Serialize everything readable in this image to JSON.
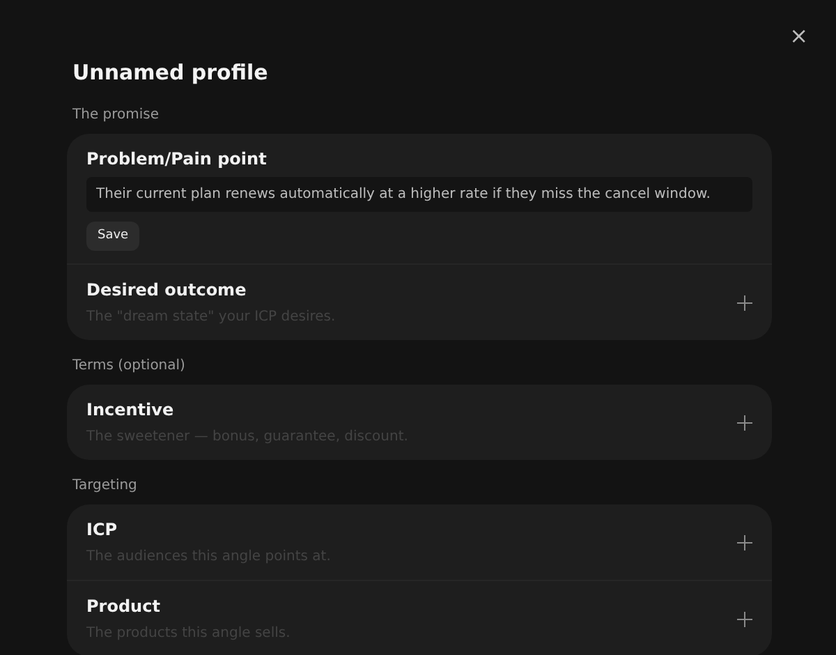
{
  "dialog": {
    "title": "Unnamed profile",
    "close_label": "×"
  },
  "sections": [
    {
      "label": "The promise",
      "fields": [
        {
          "kind": "editing",
          "label": "Problem/Pain point",
          "value": "Their current plan renews automatically at a higher rate if they miss the cancel window.",
          "button": "Save"
        },
        {
          "kind": "collapsed",
          "label": "Desired outcome",
          "description": "The \"dream state\" your ICP desires."
        }
      ]
    },
    {
      "label": "Terms (optional)",
      "fields": [
        {
          "kind": "collapsed",
          "label": "Incentive",
          "description": "The sweetener — bonus, guarantee, discount."
        }
      ]
    },
    {
      "label": "Targeting",
      "fields": [
        {
          "kind": "collapsed",
          "label": "ICP",
          "description": "The audiences this angle points at."
        },
        {
          "kind": "collapsed",
          "label": "Product",
          "description": "The products this angle sells."
        }
      ]
    }
  ]
}
